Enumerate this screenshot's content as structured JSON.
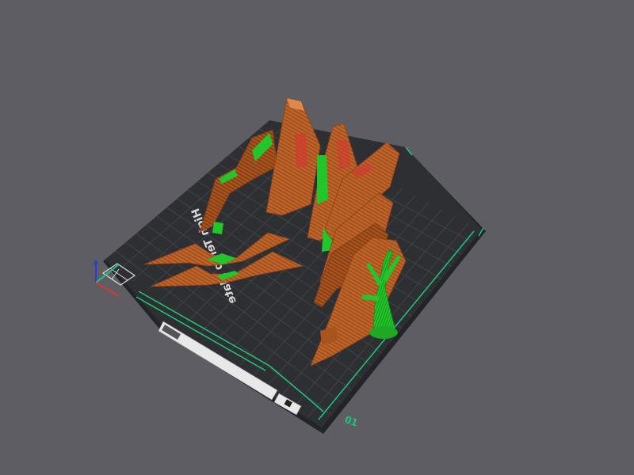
{
  "viewport": {
    "background": "#5d5d63"
  },
  "build_plate": {
    "label_mirrored": "High Temp Plate",
    "plate_number": "01",
    "plate_color": "#2e2f33",
    "grid_color": "#44464b",
    "border_accent": "#1fc77a"
  },
  "colors": {
    "part_body": "#c0642a",
    "part_dark": "#8a4217",
    "part_light": "#db8a4e",
    "support": "#22c52a",
    "support_dark": "#168a1b",
    "overhang": "#d23a32"
  },
  "axis_gizmo": {
    "icons": [
      "z-axis-icon",
      "y-axis-icon",
      "x-axis-icon"
    ]
  }
}
